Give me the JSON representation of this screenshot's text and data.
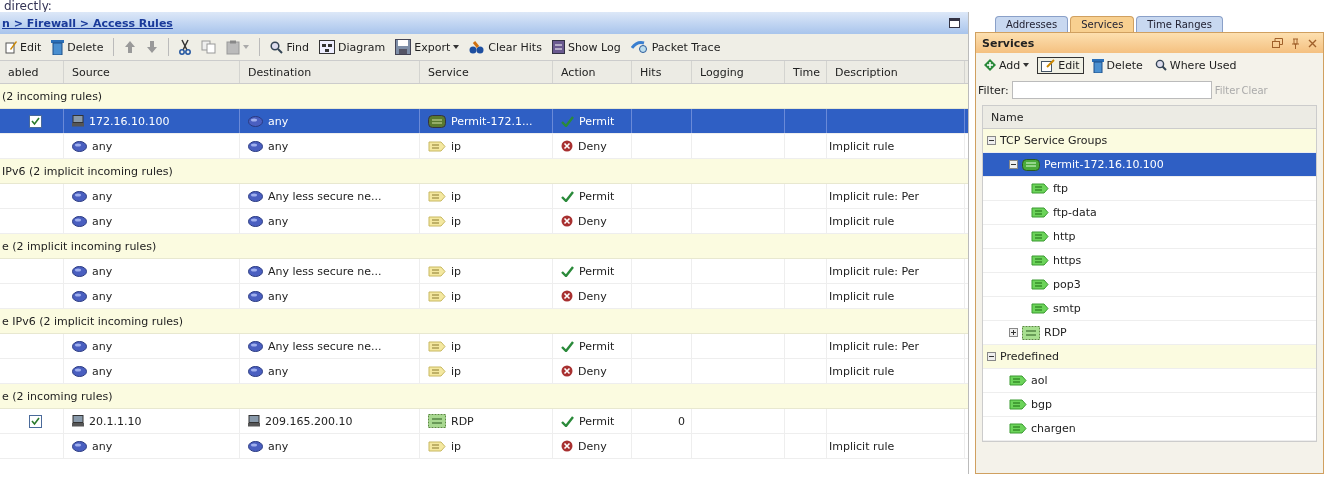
{
  "top_text": "directly:",
  "breadcrumb": "n > Firewall > Access Rules",
  "toolbar": [
    {
      "kind": "edit",
      "label": "Edit"
    },
    {
      "kind": "delete",
      "label": "Delete"
    },
    {
      "kind": "sep"
    },
    {
      "kind": "up"
    },
    {
      "kind": "down"
    },
    {
      "kind": "sep"
    },
    {
      "kind": "cut"
    },
    {
      "kind": "copy"
    },
    {
      "kind": "paste"
    },
    {
      "kind": "sep"
    },
    {
      "kind": "find",
      "label": "Find"
    },
    {
      "kind": "diagram",
      "label": "Diagram"
    },
    {
      "kind": "export",
      "label": "Export"
    },
    {
      "kind": "clear",
      "label": "Clear Hits"
    },
    {
      "kind": "log",
      "label": "Show Log"
    },
    {
      "kind": "trace",
      "label": "Packet Trace"
    }
  ],
  "table": {
    "columns": [
      "abled",
      "Source",
      "Destination",
      "Service",
      "Action",
      "Hits",
      "Logging",
      "Time",
      "Description"
    ],
    "rows": [
      {
        "kind": "group",
        "label": "(2 incoming rules)"
      },
      {
        "kind": "rule",
        "selected": true,
        "enabled": true,
        "source": {
          "kind": "host",
          "text": "172.16.10.100"
        },
        "destination": {
          "kind": "network",
          "text": "any"
        },
        "service": {
          "kind": "group",
          "text": "Permit-172.1..."
        },
        "action": {
          "kind": "permit",
          "text": "Permit"
        }
      },
      {
        "kind": "rule",
        "selected": false,
        "source": {
          "kind": "network",
          "text": "any"
        },
        "destination": {
          "kind": "network",
          "text": "any"
        },
        "service": {
          "kind": "ip",
          "text": "ip"
        },
        "action": {
          "kind": "deny",
          "text": "Deny"
        },
        "description": "Implicit rule"
      },
      {
        "kind": "group",
        "label": "IPv6 (2 implicit incoming rules)"
      },
      {
        "kind": "rule",
        "selected": false,
        "source": {
          "kind": "network",
          "text": "any"
        },
        "destination": {
          "kind": "network",
          "text": "Any less secure ne..."
        },
        "service": {
          "kind": "ip",
          "text": "ip"
        },
        "action": {
          "kind": "permit",
          "text": "Permit"
        },
        "description": "Implicit rule: Per"
      },
      {
        "kind": "rule",
        "selected": false,
        "source": {
          "kind": "network",
          "text": "any"
        },
        "destination": {
          "kind": "network",
          "text": "any"
        },
        "service": {
          "kind": "ip",
          "text": "ip"
        },
        "action": {
          "kind": "deny",
          "text": "Deny"
        },
        "description": "Implicit rule"
      },
      {
        "kind": "group",
        "label": "e (2 implicit incoming rules)"
      },
      {
        "kind": "rule",
        "selected": false,
        "source": {
          "kind": "network",
          "text": "any"
        },
        "destination": {
          "kind": "network",
          "text": "Any less secure ne..."
        },
        "service": {
          "kind": "ip",
          "text": "ip"
        },
        "action": {
          "kind": "permit",
          "text": "Permit"
        },
        "description": "Implicit rule: Per"
      },
      {
        "kind": "rule",
        "selected": false,
        "source": {
          "kind": "network",
          "text": "any"
        },
        "destination": {
          "kind": "network",
          "text": "any"
        },
        "service": {
          "kind": "ip",
          "text": "ip"
        },
        "action": {
          "kind": "deny",
          "text": "Deny"
        },
        "description": "Implicit rule"
      },
      {
        "kind": "group",
        "label": "e IPv6 (2 implicit incoming rules)"
      },
      {
        "kind": "rule",
        "selected": false,
        "source": {
          "kind": "network",
          "text": "any"
        },
        "destination": {
          "kind": "network",
          "text": "Any less secure ne..."
        },
        "service": {
          "kind": "ip",
          "text": "ip"
        },
        "action": {
          "kind": "permit",
          "text": "Permit"
        },
        "description": "Implicit rule: Per"
      },
      {
        "kind": "rule",
        "selected": false,
        "source": {
          "kind": "network",
          "text": "any"
        },
        "destination": {
          "kind": "network",
          "text": "any"
        },
        "service": {
          "kind": "ip",
          "text": "ip"
        },
        "action": {
          "kind": "deny",
          "text": "Deny"
        },
        "description": "Implicit rule"
      },
      {
        "kind": "group",
        "label": "e (2 incoming rules)"
      },
      {
        "kind": "rule",
        "selected": false,
        "enabled": true,
        "source": {
          "kind": "host",
          "text": "20.1.1.10"
        },
        "destination": {
          "kind": "host",
          "text": "209.165.200.10"
        },
        "service": {
          "kind": "rdp",
          "text": "RDP"
        },
        "action": {
          "kind": "permit",
          "text": "Permit"
        },
        "hits": "0"
      },
      {
        "kind": "rule",
        "selected": false,
        "source": {
          "kind": "network",
          "text": "any"
        },
        "destination": {
          "kind": "network",
          "text": "any"
        },
        "service": {
          "kind": "ip",
          "text": "ip"
        },
        "action": {
          "kind": "deny",
          "text": "Deny"
        },
        "description": "Implicit rule"
      }
    ]
  },
  "side": {
    "tabs": [
      {
        "label": "Addresses",
        "selected": false
      },
      {
        "label": "Services",
        "selected": true
      },
      {
        "label": "Time Ranges",
        "selected": false
      }
    ],
    "title": "Services",
    "toolbar": [
      {
        "kind": "add",
        "label": "Add",
        "pressed": false
      },
      {
        "kind": "edit",
        "label": "Edit",
        "pressed": true
      },
      {
        "kind": "delete",
        "label": "Delete",
        "pressed": false
      },
      {
        "kind": "where",
        "label": "Where Used",
        "pressed": false
      }
    ],
    "filter_label": "Filter:",
    "filter_buttons": [
      {
        "label": "Filter",
        "disabled": true
      },
      {
        "label": "Clear",
        "disabled": true
      }
    ],
    "column": "Name",
    "tree": [
      {
        "kind": "folder",
        "label": "TCP Service Groups",
        "expanded": true,
        "selected": false,
        "children": [
          {
            "kind": "group",
            "label": "Permit-172.16.10.100",
            "expanded": true,
            "selected": true,
            "children": [
              {
                "kind": "service",
                "label": "ftp",
                "selected": false
              },
              {
                "kind": "service",
                "label": "ftp-data",
                "selected": false
              },
              {
                "kind": "service",
                "label": "http",
                "selected": false
              },
              {
                "kind": "service",
                "label": "https",
                "selected": false
              },
              {
                "kind": "service",
                "label": "pop3",
                "selected": false
              },
              {
                "kind": "service",
                "label": "smtp",
                "selected": false
              }
            ]
          },
          {
            "kind": "rdp",
            "label": "RDP",
            "expanded": false,
            "selected": false
          }
        ]
      },
      {
        "kind": "folder",
        "label": "Predefined",
        "expanded": true,
        "selected": false,
        "children": [
          {
            "kind": "service",
            "label": "aol",
            "selected": false
          },
          {
            "kind": "service",
            "label": "bgp",
            "selected": false
          },
          {
            "kind": "service",
            "label": "chargen",
            "selected": false
          }
        ]
      }
    ]
  }
}
